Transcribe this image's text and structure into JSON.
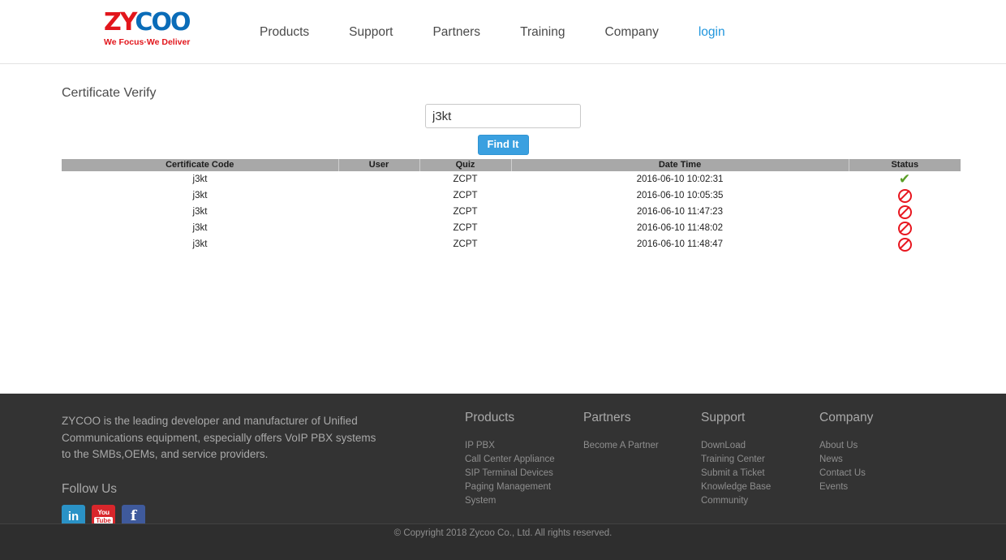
{
  "header": {
    "logo": {
      "mark_zy": "ZY",
      "mark_coo": "COO",
      "tagline": "We Focus·We Deliver"
    },
    "nav": [
      {
        "label": "Products",
        "type": "link"
      },
      {
        "label": "Support",
        "type": "link"
      },
      {
        "label": "Partners",
        "type": "link"
      },
      {
        "label": "Training",
        "type": "link"
      },
      {
        "label": "Company",
        "type": "link"
      },
      {
        "label": "login",
        "type": "link-accent"
      }
    ],
    "accent_color": "#2196dd"
  },
  "main": {
    "page_title": "Certificate Verify",
    "search": {
      "value": "j3kt",
      "placeholder": "",
      "button_label": "Find It",
      "button_color": "#3aa0e0"
    },
    "table": {
      "columns": [
        "Certificate Code",
        "User",
        "Quiz",
        "Date Time",
        "Status"
      ],
      "rows": [
        {
          "code": "j3kt",
          "user": "",
          "quiz": "ZCPT",
          "datetime": "2016-06-10 10:02:31",
          "status": "valid"
        },
        {
          "code": "j3kt",
          "user": "",
          "quiz": "ZCPT",
          "datetime": "2016-06-10 10:05:35",
          "status": "invalid"
        },
        {
          "code": "j3kt",
          "user": "",
          "quiz": "ZCPT",
          "datetime": "2016-06-10 11:47:23",
          "status": "invalid"
        },
        {
          "code": "j3kt",
          "user": "",
          "quiz": "ZCPT",
          "datetime": "2016-06-10 11:48:02",
          "status": "invalid"
        },
        {
          "code": "j3kt",
          "user": "",
          "quiz": "ZCPT",
          "datetime": "2016-06-10 11:48:47",
          "status": "invalid"
        }
      ],
      "status_icons": {
        "valid": "check-icon",
        "invalid": "prohibited-icon"
      },
      "status_colors": {
        "valid": "#5a9e26",
        "invalid": "#e8161f"
      },
      "header_bg": "#a8a8a8"
    }
  },
  "footer": {
    "about_text": "ZYCOO is the leading developer and manufacturer of Unified Communications equipment, especially offers VoIP PBX systems to the SMBs,OEMs, and service providers.",
    "follow_title": "Follow Us",
    "social": [
      {
        "name": "linkedin",
        "label": "in",
        "color": "#2a92c6"
      },
      {
        "name": "youtube",
        "label_top": "You",
        "label_bottom": "Tube",
        "color": "#d8262b"
      },
      {
        "name": "facebook",
        "label": "f",
        "color": "#3f5a9c"
      }
    ],
    "columns": [
      {
        "title": "Products",
        "links": [
          "IP PBX",
          "Call Center Appliance",
          "SIP Terminal Devices",
          "Paging Management System"
        ]
      },
      {
        "title": "Partners",
        "links": [
          "Become A Partner"
        ]
      },
      {
        "title": "Support",
        "links": [
          "DownLoad",
          "Training Center",
          "Submit a Ticket",
          "Knowledge Base",
          "Community"
        ]
      },
      {
        "title": "Company",
        "links": [
          "About Us",
          "News",
          "Contact Us",
          "Events"
        ]
      }
    ],
    "copyright": "© Copyright 2018 Zycoo Co., Ltd. All rights reserved.",
    "background": "#333333"
  }
}
